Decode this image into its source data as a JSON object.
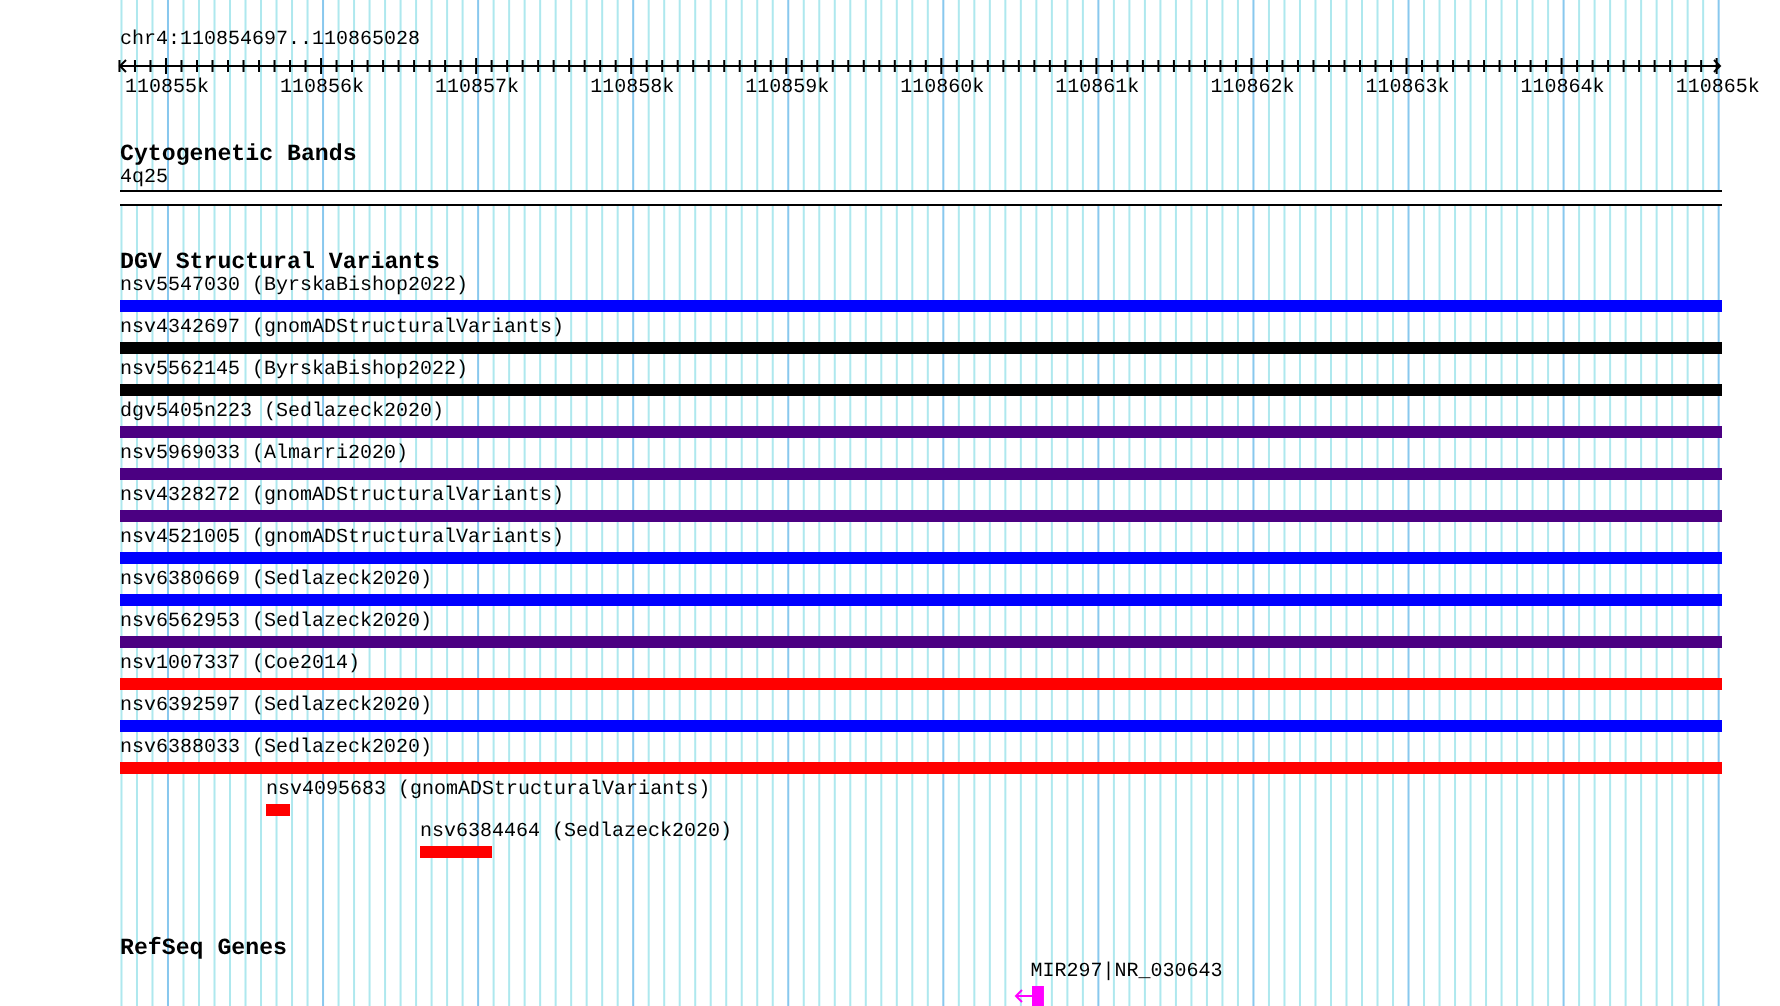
{
  "ruler": {
    "location": "chr4:110854697..110865028",
    "ticks": [
      "110855k",
      "110856k",
      "110857k",
      "110858k",
      "110859k",
      "110860k",
      "110861k",
      "110862k",
      "110863k",
      "110864k",
      "110865k"
    ]
  },
  "tracks": [
    {
      "kind": "bands",
      "title": "Cytogenetic Bands",
      "features": [
        {
          "label": "4q25"
        }
      ]
    },
    {
      "kind": "variants",
      "title": "DGV Structural Variants",
      "features": [
        {
          "label": "nsv5547030 (ByrskaBishop2022)",
          "color": "#0000ff"
        },
        {
          "label": "nsv4342697 (gnomADStructuralVariants)",
          "color": "#000000"
        },
        {
          "label": "nsv5562145 (ByrskaBishop2022)",
          "color": "#000000"
        },
        {
          "label": "dgv5405n223 (Sedlazeck2020)",
          "color": "#4b0082"
        },
        {
          "label": "nsv5969033 (Almarri2020)",
          "color": "#4b0082"
        },
        {
          "label": "nsv4328272 (gnomADStructuralVariants)",
          "color": "#4b0082"
        },
        {
          "label": "nsv4521005 (gnomADStructuralVariants)",
          "color": "#0000ff"
        },
        {
          "label": "nsv6380669 (Sedlazeck2020)",
          "color": "#0000ff"
        },
        {
          "label": "nsv6562953 (Sedlazeck2020)",
          "color": "#4b0082"
        },
        {
          "label": "nsv1007337 (Coe2014)",
          "color": "#ff0000"
        },
        {
          "label": "nsv6392597 (Sedlazeck2020)",
          "color": "#0000ff"
        },
        {
          "label": "nsv6388033 (Sedlazeck2020)",
          "color": "#ff0000"
        },
        {
          "label": "nsv4095683 (gnomADStructuralVariants)",
          "color": "#ff0000"
        },
        {
          "label": "nsv6384464 (Sedlazeck2020)",
          "color": "#ff0000"
        }
      ]
    },
    {
      "kind": "genes",
      "title": "RefSeq Genes",
      "features": [
        {
          "label": "MIR297|NR_030643",
          "reverse_strand": true
        }
      ]
    }
  ]
}
